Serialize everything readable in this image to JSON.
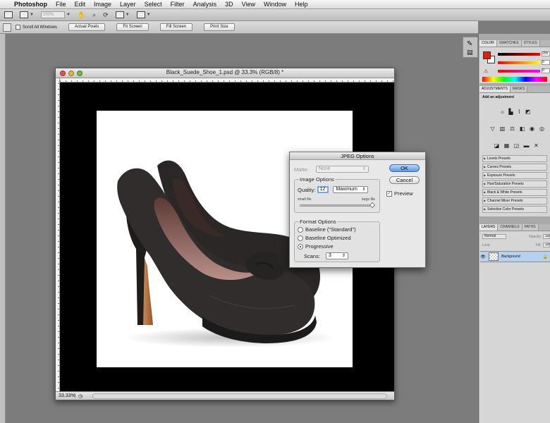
{
  "menubar": {
    "app": "Photoshop",
    "items": [
      "File",
      "Edit",
      "Image",
      "Layer",
      "Select",
      "Filter",
      "Analysis",
      "3D",
      "View",
      "Window",
      "Help"
    ]
  },
  "appbar": {
    "zoom": "100%"
  },
  "options": {
    "scroll_all_windows": "Scroll All Windows",
    "buttons": [
      "Actual Pixels",
      "Fit Screen",
      "Fill Screen",
      "Print Size"
    ]
  },
  "document": {
    "title": "Black_Suede_Shoe_1.psd @ 33.3% (RGB/8) *",
    "zoom_status": "33.33%"
  },
  "dialog": {
    "title": "JPEG Options",
    "matte_label": "Matte:",
    "matte_value": "None",
    "image_options": "Image Options",
    "quality_label": "Quality:",
    "quality_value": "12",
    "quality_preset": "Maximum",
    "small_file": "small file",
    "large_file": "large file",
    "quality_fraction": 1.0,
    "format_options": "Format Options",
    "formats": [
      "Baseline (\"Standard\")",
      "Baseline Optimized",
      "Progressive"
    ],
    "selected_format": 2,
    "scans_label": "Scans:",
    "scans_value": "3",
    "ok": "OK",
    "cancel": "Cancel",
    "preview": "Preview",
    "preview_checked": true
  },
  "panels": {
    "color_tabs": [
      "COLOR",
      "SWATCHES",
      "STYLES"
    ],
    "color_values": [
      "255",
      "0",
      "0"
    ],
    "fg_color": "#e51d0f",
    "bg_color": "#ffffff",
    "adjust_tabs": [
      "ADJUSTMENTS",
      "MASKS"
    ],
    "add_adjustment": "Add an adjustment",
    "presets": [
      "Levels Presets",
      "Curves Presets",
      "Exposure Presets",
      "Hue/Saturation Presets",
      "Black & White Presets",
      "Channel Mixer Presets",
      "Selective Color Presets"
    ],
    "layers_tabs": [
      "LAYERS",
      "CHANNELS",
      "PATHS"
    ],
    "blend_mode": "Normal",
    "opacity_label": "Opacity:",
    "lock_label": "Lock:",
    "fill_label": "Fill:",
    "fill_value": "100",
    "opacity_value": "100",
    "layer_name": "Background"
  }
}
